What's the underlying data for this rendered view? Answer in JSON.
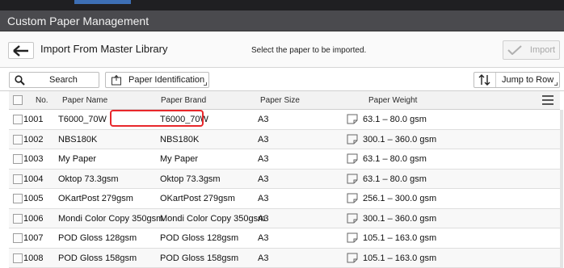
{
  "window": {
    "title": "Custom Paper Management"
  },
  "header": {
    "back_icon": "arrow-left-icon",
    "title": "Import From Master Library",
    "instruction": "Select the paper to be imported.",
    "import_label": "Import"
  },
  "toolbar": {
    "search_label": "Search",
    "paper_identification_label": "Paper Identification",
    "jump_label": "Jump to Row"
  },
  "table": {
    "columns": [
      "No.",
      "Paper Name",
      "Paper Brand",
      "Paper Size",
      "Paper Weight"
    ],
    "rows": [
      {
        "no": "1001",
        "name": "T6000_70W",
        "brand": "T6000_70W",
        "size": "A3",
        "weight": "63.1 – 80.0 gsm"
      },
      {
        "no": "1002",
        "name": "NBS180K",
        "brand": "NBS180K",
        "size": "A3",
        "weight": "300.1 – 360.0 gsm"
      },
      {
        "no": "1003",
        "name": "My Paper",
        "brand": "My Paper",
        "size": "A3",
        "weight": "63.1 – 80.0 gsm"
      },
      {
        "no": "1004",
        "name": "Oktop 73.3gsm",
        "brand": "Oktop 73.3gsm",
        "size": "A3",
        "weight": "63.1 – 80.0 gsm"
      },
      {
        "no": "1005",
        "name": "OKartPost 279gsm",
        "brand": "OKartPost 279gsm",
        "size": "A3",
        "weight": "256.1 – 300.0 gsm"
      },
      {
        "no": "1006",
        "name": "Mondi Color Copy 350gsm",
        "brand": "Mondi Color Copy 350gsm",
        "size": "A3",
        "weight": "300.1 – 360.0 gsm"
      },
      {
        "no": "1007",
        "name": "POD Gloss 128gsm",
        "brand": "POD Gloss 128gsm",
        "size": "A3",
        "weight": "105.1 – 163.0 gsm"
      },
      {
        "no": "1008",
        "name": "POD Gloss 158gsm",
        "brand": "POD Gloss 158gsm",
        "size": "A3",
        "weight": "105.1 – 163.0 gsm"
      }
    ]
  },
  "colors": {
    "titlebar": "#4a4a4e",
    "highlight": "#e8272b",
    "accent": "#3d6fb5"
  }
}
